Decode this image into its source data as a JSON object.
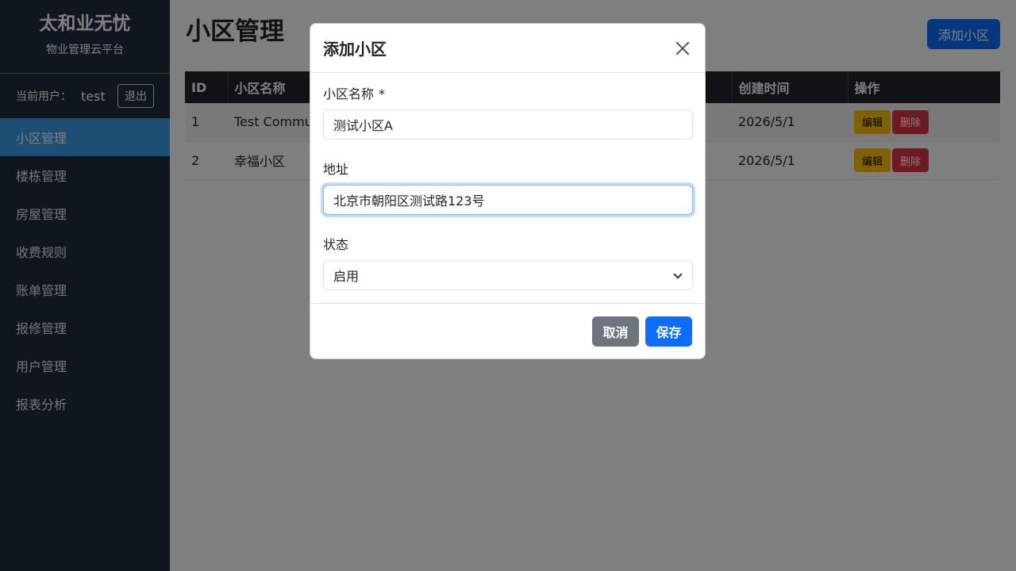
{
  "sidebar": {
    "brand_title": "太和业无忧",
    "brand_subtitle": "物业管理云平台",
    "user_label": "当前用户：",
    "user_name": "test",
    "logout_label": "退出",
    "items": [
      {
        "label": "小区管理",
        "active": true
      },
      {
        "label": "楼栋管理"
      },
      {
        "label": "房屋管理"
      },
      {
        "label": "收费规则"
      },
      {
        "label": "账单管理"
      },
      {
        "label": "报修管理"
      },
      {
        "label": "用户管理"
      },
      {
        "label": "报表分析"
      }
    ]
  },
  "main": {
    "title": "小区管理",
    "add_button": "添加小区",
    "table": {
      "columns": [
        "ID",
        "小区名称",
        "",
        "创建时间",
        "操作"
      ],
      "rows": [
        {
          "id": "1",
          "name": "Test Commu",
          "created": "2026/5/1"
        },
        {
          "id": "2",
          "name": "幸福小区",
          "created": "2026/5/1"
        }
      ],
      "edit_label": "编辑",
      "delete_label": "删除"
    }
  },
  "modal": {
    "title": "添加小区",
    "name_label": "小区名称",
    "required_mark": "*",
    "name_value": "测试小区A",
    "address_label": "地址",
    "address_value": "北京市朝阳区测试路123号",
    "status_label": "状态",
    "status_value": "启用",
    "cancel_label": "取消",
    "save_label": "保存"
  }
}
